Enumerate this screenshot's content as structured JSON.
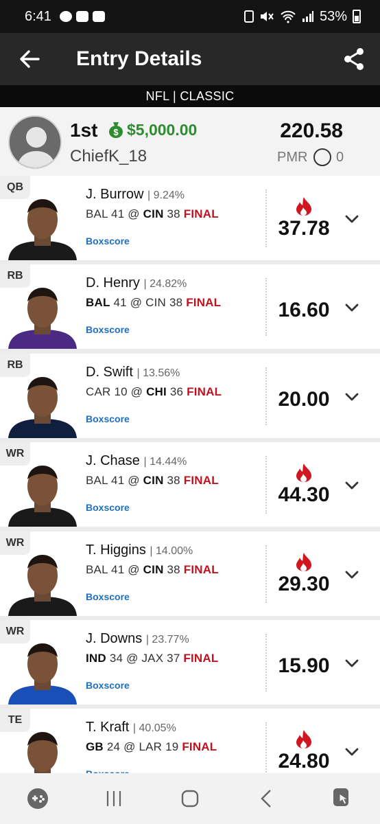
{
  "status_bar": {
    "time": "6:41",
    "battery": "53%"
  },
  "header": {
    "title": "Entry Details"
  },
  "subheader": {
    "text": "NFL | CLASSIC"
  },
  "entry": {
    "rank": "1st",
    "prize": "$5,000.00",
    "username": "ChiefK_18",
    "total_points": "220.58",
    "pmr_label": "PMR",
    "pmr_value": "0"
  },
  "players": [
    {
      "pos": "QB",
      "name": "J. Burrow",
      "own": "| 9.24%",
      "away": "BAL",
      "away_score": "41",
      "home": "CIN",
      "home_score": "38",
      "bold": "home",
      "status": "FINAL",
      "boxscore": "Boxscore",
      "points": "37.78",
      "hot": true
    },
    {
      "pos": "RB",
      "name": "D. Henry",
      "own": "| 24.82%",
      "away": "BAL",
      "away_score": "41",
      "home": "CIN",
      "home_score": "38",
      "bold": "away",
      "status": "FINAL",
      "boxscore": "Boxscore",
      "points": "16.60",
      "hot": false
    },
    {
      "pos": "RB",
      "name": "D. Swift",
      "own": "| 13.56%",
      "away": "CAR",
      "away_score": "10",
      "home": "CHI",
      "home_score": "36",
      "bold": "home",
      "status": "FINAL",
      "boxscore": "Boxscore",
      "points": "20.00",
      "hot": false
    },
    {
      "pos": "WR",
      "name": "J. Chase",
      "own": "| 14.44%",
      "away": "BAL",
      "away_score": "41",
      "home": "CIN",
      "home_score": "38",
      "bold": "home",
      "status": "FINAL",
      "boxscore": "Boxscore",
      "points": "44.30",
      "hot": true
    },
    {
      "pos": "WR",
      "name": "T. Higgins",
      "own": "| 14.00%",
      "away": "BAL",
      "away_score": "41",
      "home": "CIN",
      "home_score": "38",
      "bold": "home",
      "status": "FINAL",
      "boxscore": "Boxscore",
      "points": "29.30",
      "hot": true
    },
    {
      "pos": "WR",
      "name": "J. Downs",
      "own": "| 23.77%",
      "away": "IND",
      "away_score": "34",
      "home": "JAX",
      "home_score": "37",
      "bold": "away",
      "status": "FINAL",
      "boxscore": "Boxscore",
      "points": "15.90",
      "hot": false
    },
    {
      "pos": "TE",
      "name": "T. Kraft",
      "own": "| 40.05%",
      "away": "GB",
      "away_score": "24",
      "home": "LAR",
      "home_score": "19",
      "bold": "away",
      "status": "FINAL",
      "boxscore": "Boxscore",
      "points": "24.80",
      "hot": true
    }
  ],
  "colors": {
    "accent_blue": "#1f6fbf",
    "final_red": "#c1121f",
    "prize_green": "#2e8b2e",
    "header_bg": "#282828"
  }
}
